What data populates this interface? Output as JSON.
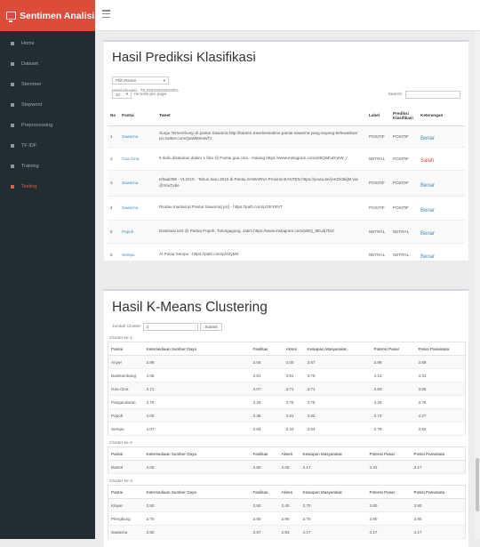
{
  "app": {
    "title": "Sentimen Analisis"
  },
  "sidebar": {
    "items": [
      {
        "label": "Home",
        "active": false
      },
      {
        "label": "Dataset",
        "active": false
      },
      {
        "label": "Stemmer",
        "active": false
      },
      {
        "label": "Stopword",
        "active": false
      },
      {
        "label": "Preprocessing",
        "active": false
      },
      {
        "label": "TF IDF",
        "active": false
      },
      {
        "label": "Training",
        "active": false
      },
      {
        "label": "Testing",
        "active": true
      }
    ]
  },
  "prediksi": {
    "title": "Hasil Prediksi Klasifikasi",
    "filter": "Pilih Pantai",
    "akurasi": "Hasil Akurasi : 75.333333333333%",
    "page_size": "10",
    "per_page": "records per page",
    "search_label": "Search:",
    "search_value": "",
    "headers": {
      "no": "No",
      "pantai": "Pantai",
      "tweet": "Tweet",
      "label": "Label",
      "prediksi": "Prediksi Klasifikasi",
      "keterangan": "Keterangan"
    },
    "rows": [
      {
        "no": "1",
        "pantai": "Sawarna",
        "tweet": "Surga Tersembunyi di pantai Sawarna http://banten.travelnesiatime.pantai-sawarna-yang-sayang-terlewatkan/ pic.twitter.com/QaW80e4wTz",
        "label": "POSITIF",
        "pred": "POSITIF",
        "ket": "Benar"
      },
      {
        "no": "2",
        "pantai": "Goa Cina",
        "tweet": "5 Ikalo disatukan dalam 1 foto @ Pantai goa cina - malang https://www.instagram.com/p/BQ9EvDrjnW_/",
        "label": "NETRAL",
        "pred": "POSITIF",
        "ket": "Salah"
      },
      {
        "no": "3",
        "pantai": "Sawarna",
        "tweet": "Ishaal355 - VLOGS - Tahun baru 2015 di Pantai SAWARNA Provinsi BANTEN https://youtu.be/jAKDk3kijM via @YouTube",
        "label": "POSITIF",
        "pred": "POSITIF",
        "ket": "Benar"
      },
      {
        "no": "4",
        "pantai": "Sawarna",
        "tweet": "Rindau mantaii:at Pantai Sawarna[ pic] - https://path.com/p/3EYRVT",
        "label": "POSITIF",
        "pred": "POSITIF",
        "ket": "Benar"
      },
      {
        "no": "5",
        "pantai": "Popoh",
        "tweet": "Destinasi ke2 @ Pantai Popoh, Tulungagung, Jatim https://www.instagram.com/p/BQ_9Eu3j7D2/",
        "label": "NETRAL",
        "pred": "NETRAL",
        "ket": "Benar"
      },
      {
        "no": "6",
        "pantai": "Sempu",
        "tweet": "At Pulau Sempu - https://path.com/p/2ZyMS",
        "label": "NETRAL",
        "pred": "NETRAL",
        "ket": "Benar"
      }
    ]
  },
  "kmeans": {
    "title": "Hasil K-Means Clustering",
    "jumlah_label": "Jumlah Cluster:",
    "jumlah_value": "3",
    "submit": "Submit",
    "clusters": [
      {
        "caption": "Cluster ke-1",
        "headers": [
          "Pantai",
          "Ketersediaan Sumber Daya",
          "Fasilitas",
          "Akses",
          "Kesiapan Masyarakat",
          "Potensi Pasar",
          "Posisi Pariwisata"
        ],
        "rows": [
          [
            "Anyer",
            "3.89",
            "3.56",
            "4.00",
            "3.67",
            "3.89",
            "3.89"
          ],
          [
            "Balekambang",
            "4.06",
            "3.81",
            "3.81",
            "3.75",
            "4.13",
            "4.31"
          ],
          [
            "Goa Cina",
            "3.71",
            "4.07",
            "3.71",
            "3.71",
            "3.93",
            "3.86"
          ],
          [
            "Pangandaran",
            "3.75",
            "3.25",
            "3.75",
            "3.75",
            "4.25",
            "3.75"
          ],
          [
            "Popoh",
            "4.00",
            "3.36",
            "3.91",
            "3.82",
            "3.73",
            "4.27"
          ],
          [
            "Sempu",
            "4.07",
            "3.64",
            "3.43",
            "3.64",
            "3.79",
            "3.93"
          ]
        ]
      },
      {
        "caption": "Cluster ke-2",
        "headers": [
          "Pantai",
          "Ketersediaan Sumber Daya",
          "Fasilitas",
          "Akses",
          "Kesiapan Masyarakat",
          "Potensi Pasar",
          "Posisi Pariwisata"
        ],
        "rows": [
          [
            "Bantol",
            "4.00",
            "3.50",
            "3.00",
            "3.17",
            "3.33",
            "3.17"
          ]
        ]
      },
      {
        "caption": "Cluster ke-3",
        "headers": [
          "Pantai",
          "Ketersediaan Sumber Daya",
          "Fasilitas",
          "Akses",
          "Kesiapan Masyarakat",
          "Potensi Pasar",
          "Posisi Pariwisata"
        ],
        "rows": [
          [
            "Klayar",
            "3.50",
            "3.50",
            "3.40",
            "3.70",
            "3.80",
            "3.90"
          ],
          [
            "Plengkung",
            "3.70",
            "3.80",
            "3.90",
            "3.70",
            "3.90",
            "3.90"
          ],
          [
            "Sawarna",
            "3.50",
            "3.67",
            "2.83",
            "4.17",
            "4.17",
            "4.17"
          ]
        ]
      }
    ]
  }
}
